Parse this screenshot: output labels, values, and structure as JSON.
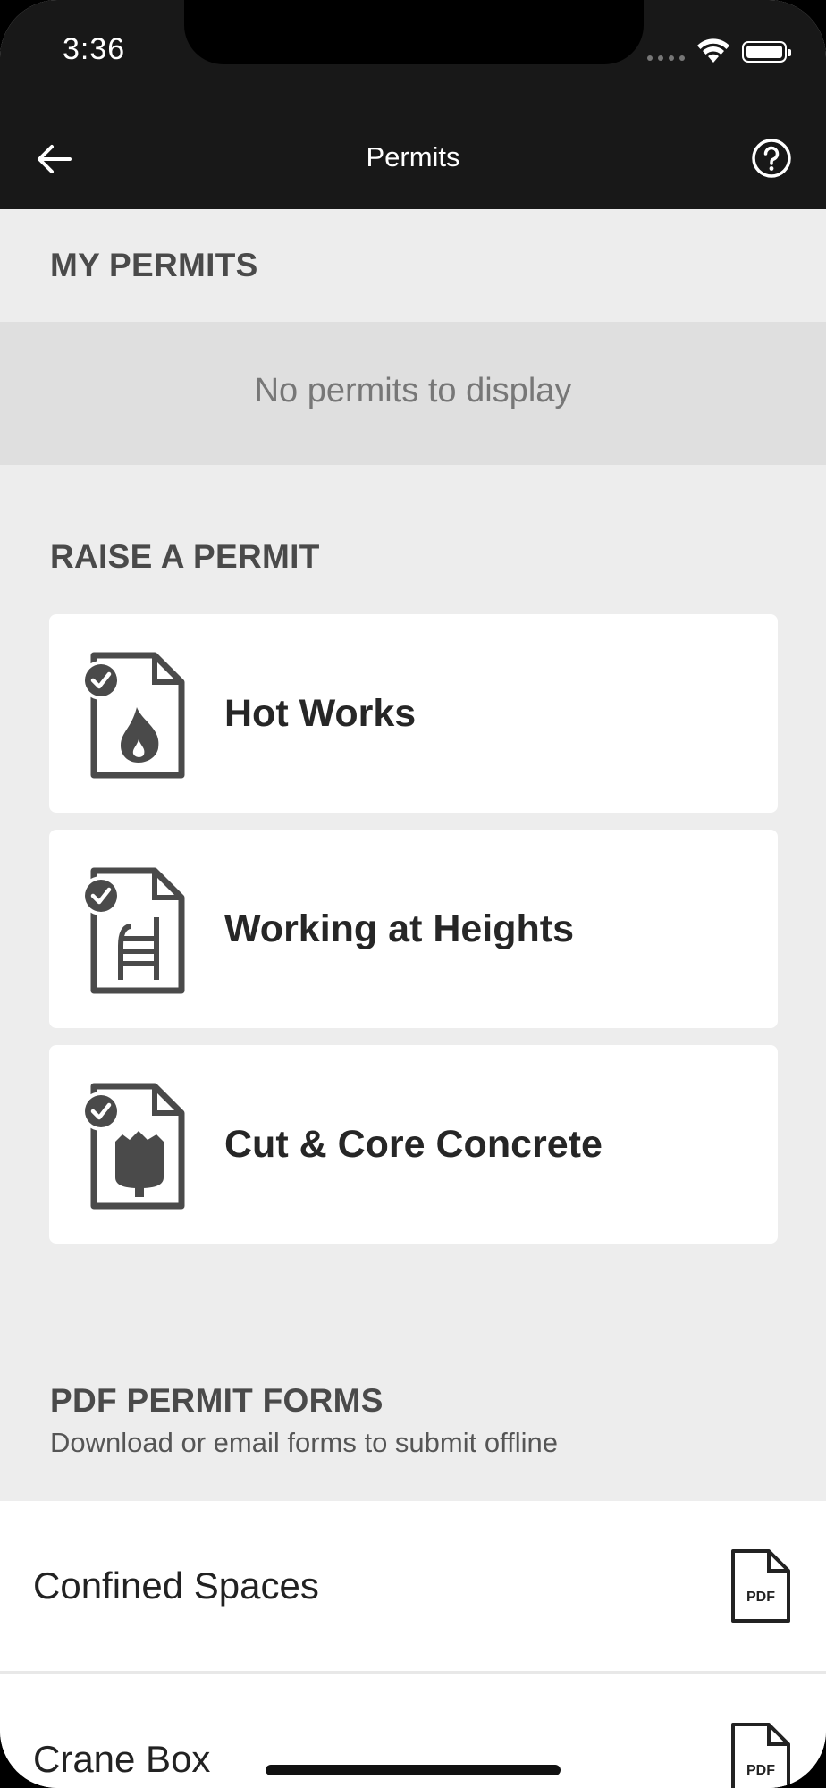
{
  "status_bar": {
    "time": "3:36"
  },
  "navbar": {
    "title": "Permits",
    "back_icon": "back-arrow-icon",
    "help_icon": "help-circle-icon"
  },
  "my_permits": {
    "heading": "MY PERMITS",
    "empty_text": "No permits to display"
  },
  "raise_permit": {
    "heading": "RAISE A PERMIT",
    "items": [
      {
        "label": "Hot Works",
        "icon": "hot-works-permit-icon"
      },
      {
        "label": "Working at Heights",
        "icon": "ladder-permit-icon"
      },
      {
        "label": "Cut & Core Concrete",
        "icon": "concrete-permit-icon"
      }
    ]
  },
  "pdf_forms": {
    "heading": "PDF PERMIT FORMS",
    "subtitle": "Download or email forms to submit offline",
    "items": [
      {
        "label": "Confined Spaces",
        "icon_text": "PDF"
      },
      {
        "label": "Crane Box",
        "icon_text": "PDF"
      }
    ]
  },
  "colors": {
    "bar": "#181818",
    "background": "#ededed",
    "card": "#ffffff",
    "icon": "#4a4a4a"
  }
}
